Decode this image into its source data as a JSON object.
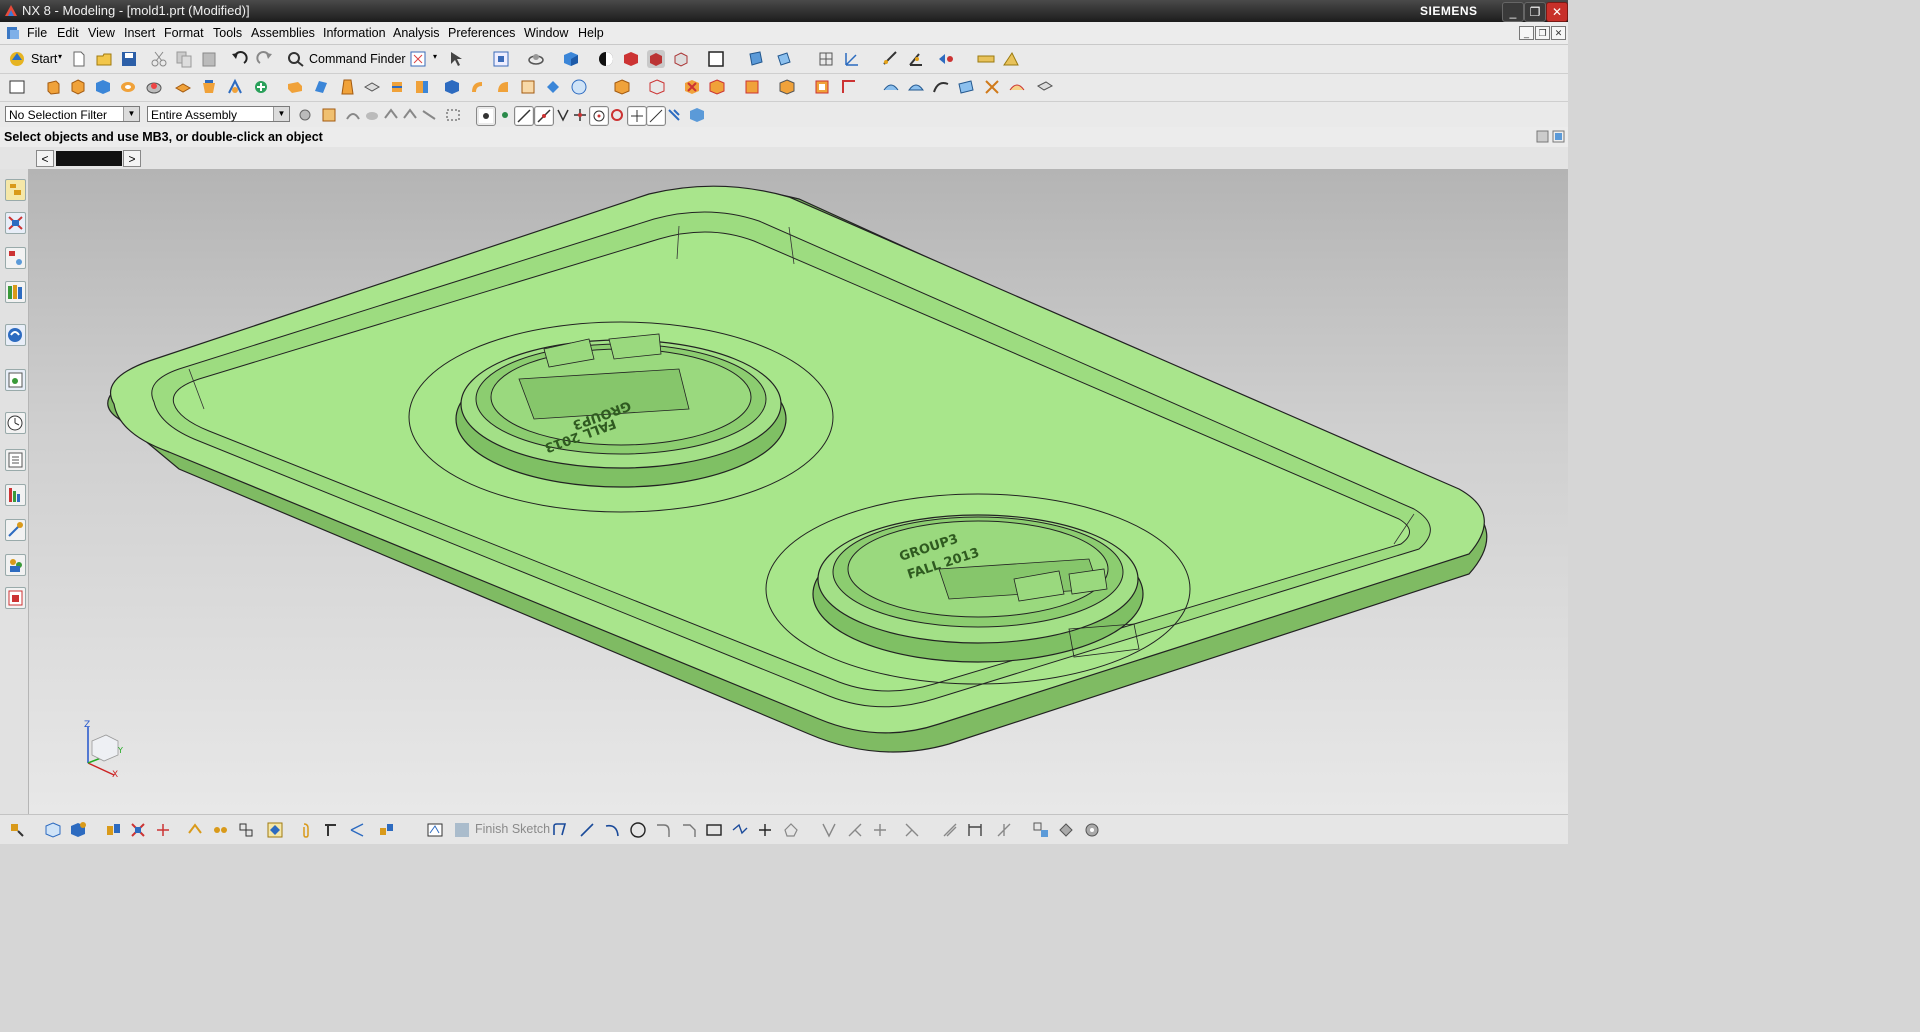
{
  "window": {
    "title": "NX 8 - Modeling - [mold1.prt (Modified)]",
    "brand": "SIEMENS",
    "minimize": "_",
    "restore": "❐",
    "close": "✕"
  },
  "menu": {
    "items": [
      "File",
      "Edit",
      "View",
      "Insert",
      "Format",
      "Tools",
      "Assemblies",
      "Information",
      "Analysis",
      "Preferences",
      "Window",
      "Help"
    ]
  },
  "standard_toolbar": {
    "start_label": "Start",
    "command_finder_label": "Command Finder"
  },
  "selection_bar": {
    "filter_value": "No Selection Filter",
    "scope_value": "Entire Assembly"
  },
  "status": {
    "message": "Select objects and use MB3, or double-click an object"
  },
  "tabs": {
    "prev": "<",
    "next": ">"
  },
  "sketch_toolbar": {
    "finish_sketch_label": "Finish Sketch"
  },
  "triad": {
    "z_label": "Z",
    "x_label": "X",
    "y_label": "Y"
  },
  "model": {
    "emboss_text_line1": "GROUP3",
    "emboss_text_line2": "FALL 2013",
    "part_color": "#a6e585"
  },
  "colors": {
    "titlebar": "#2a2a2a",
    "close_button": "#c8302a",
    "viewport_top": "#b4b4b4",
    "viewport_bottom": "#e8e8e8"
  }
}
